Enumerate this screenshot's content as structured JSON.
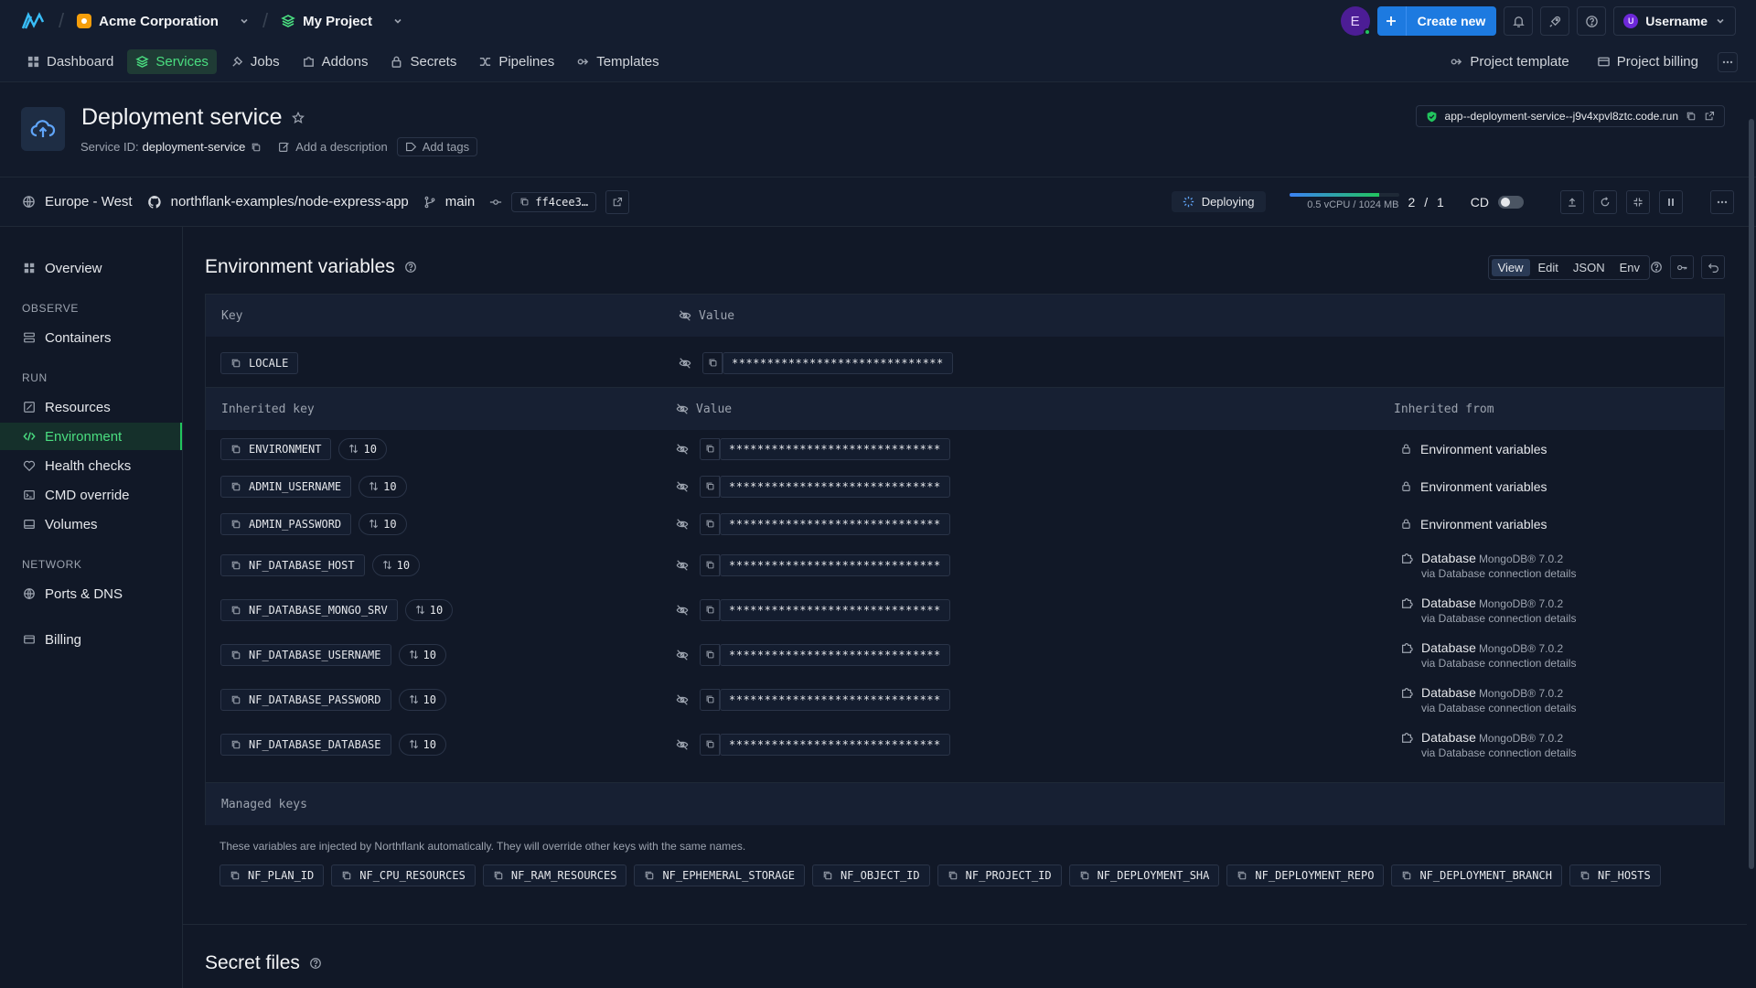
{
  "topbar": {
    "org": "Acme Corporation",
    "project": "My Project",
    "avatar_initial": "E",
    "create_label": "Create new",
    "username": "Username",
    "username_initial": "U"
  },
  "nav": {
    "items": [
      {
        "label": "Dashboard",
        "icon": "grid-icon"
      },
      {
        "label": "Services",
        "icon": "layers-icon",
        "active": true
      },
      {
        "label": "Jobs",
        "icon": "job-icon"
      },
      {
        "label": "Addons",
        "icon": "puzzle-icon"
      },
      {
        "label": "Secrets",
        "icon": "lock-icon"
      },
      {
        "label": "Pipelines",
        "icon": "pipeline-icon"
      },
      {
        "label": "Templates",
        "icon": "template-icon"
      }
    ],
    "project_template": "Project template",
    "project_billing": "Project billing"
  },
  "service": {
    "title": "Deployment service",
    "id_label": "Service ID:",
    "id_value": "deployment-service",
    "add_description": "Add a description",
    "add_tags": "Add tags",
    "url": "app--deployment-service--j9v4xpvl8ztc.code.run"
  },
  "deploy": {
    "region": "Europe - West",
    "repo": "northflank-examples/node-express-app",
    "branch": "main",
    "commit": "ff4cee3…",
    "status": "Deploying",
    "resources": "0.5 vCPU / 1024 MB",
    "resource_fill_fraction": 0.82,
    "instances": "2 / 1",
    "cd_label": "CD"
  },
  "sidebar": {
    "overview": "Overview",
    "groups": [
      {
        "title": "OBSERVE",
        "items": [
          {
            "label": "Containers",
            "icon": "containers-icon"
          }
        ]
      },
      {
        "title": "RUN",
        "items": [
          {
            "label": "Resources",
            "icon": "resources-icon"
          },
          {
            "label": "Environment",
            "icon": "code-icon",
            "active": true
          },
          {
            "label": "Health checks",
            "icon": "heart-icon"
          },
          {
            "label": "CMD override",
            "icon": "terminal-icon"
          },
          {
            "label": "Volumes",
            "icon": "volume-icon"
          }
        ]
      },
      {
        "title": "NETWORK",
        "items": [
          {
            "label": "Ports & DNS",
            "icon": "globe-icon"
          }
        ]
      }
    ],
    "billing": "Billing"
  },
  "env": {
    "title": "Environment variables",
    "modes": [
      "View",
      "Edit",
      "JSON",
      "Env"
    ],
    "active_mode": "View",
    "key_header": "Key",
    "value_header": "Value",
    "keys": [
      {
        "key": "LOCALE",
        "value": "******************************"
      }
    ],
    "inherited_key_header": "Inherited key",
    "inherited_from_header": "Inherited from",
    "inherited": [
      {
        "key": "ENVIRONMENT",
        "count": "10",
        "value": "******************************",
        "from": "Environment variables",
        "kind": "lock"
      },
      {
        "key": "ADMIN_USERNAME",
        "count": "10",
        "value": "******************************",
        "from": "Environment variables",
        "kind": "lock"
      },
      {
        "key": "ADMIN_PASSWORD",
        "count": "10",
        "value": "******************************",
        "from": "Environment variables",
        "kind": "lock"
      },
      {
        "key": "NF_DATABASE_HOST",
        "count": "10",
        "value": "******************************",
        "from": "Database",
        "db": "MongoDB® 7.0.2",
        "via": "via Database connection details",
        "kind": "db"
      },
      {
        "key": "NF_DATABASE_MONGO_SRV",
        "count": "10",
        "value": "******************************",
        "from": "Database",
        "db": "MongoDB® 7.0.2",
        "via": "via Database connection details",
        "kind": "db"
      },
      {
        "key": "NF_DATABASE_USERNAME",
        "count": "10",
        "value": "******************************",
        "from": "Database",
        "db": "MongoDB® 7.0.2",
        "via": "via Database connection details",
        "kind": "db"
      },
      {
        "key": "NF_DATABASE_PASSWORD",
        "count": "10",
        "value": "******************************",
        "from": "Database",
        "db": "MongoDB® 7.0.2",
        "via": "via Database connection details",
        "kind": "db"
      },
      {
        "key": "NF_DATABASE_DATABASE",
        "count": "10",
        "value": "******************************",
        "from": "Database",
        "db": "MongoDB® 7.0.2",
        "via": "via Database connection details",
        "kind": "db"
      }
    ],
    "managed_header": "Managed keys",
    "managed_note": "These variables are injected by Northflank automatically. They will override other keys with the same names.",
    "managed": [
      "NF_PLAN_ID",
      "NF_CPU_RESOURCES",
      "NF_RAM_RESOURCES",
      "NF_EPHEMERAL_STORAGE",
      "NF_OBJECT_ID",
      "NF_PROJECT_ID",
      "NF_DEPLOYMENT_SHA",
      "NF_DEPLOYMENT_REPO",
      "NF_DEPLOYMENT_BRANCH",
      "NF_HOSTS"
    ]
  },
  "secret_files": {
    "title": "Secret files"
  }
}
